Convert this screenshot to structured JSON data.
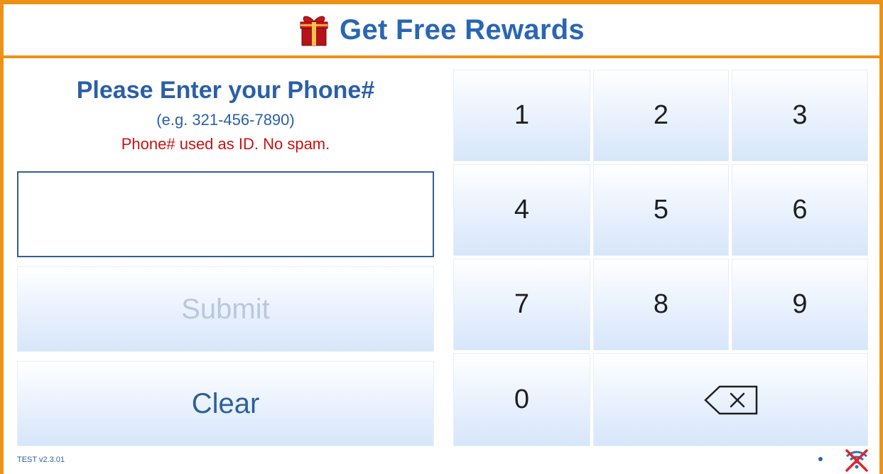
{
  "header": {
    "title": "Get Free Rewards",
    "icon": "gift-icon"
  },
  "prompt": {
    "heading": "Please Enter your Phone#",
    "example": "(e.g. 321-456-7890)",
    "note": "Phone# used as ID. No spam."
  },
  "phone_input": {
    "value": "",
    "placeholder": ""
  },
  "buttons": {
    "submit_label": "Submit",
    "clear_label": "Clear"
  },
  "keypad": {
    "keys": [
      "1",
      "2",
      "3",
      "4",
      "5",
      "6",
      "7",
      "8",
      "9",
      "0"
    ],
    "backspace_icon": "backspace-icon"
  },
  "footer": {
    "version": "TEST v2.3.01",
    "status_icon": "wifi-disconnected-icon"
  },
  "colors": {
    "accent_border": "#ec9216",
    "title_blue": "#2a66b2",
    "note_red": "#cc1111",
    "submit_disabled": "#b9c8dc"
  }
}
